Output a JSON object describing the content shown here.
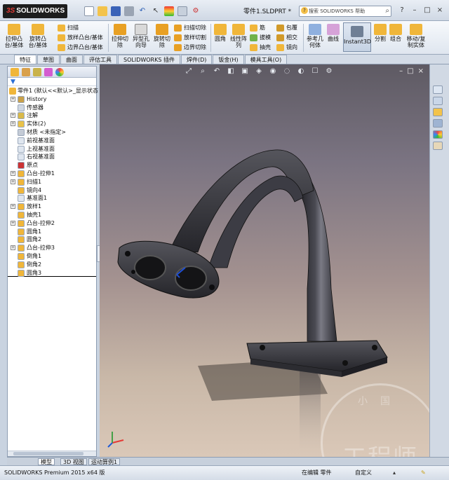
{
  "app": {
    "logo_text": "SOLIDWORKS",
    "doc_title": "零件1.SLDPRT *",
    "search_placeholder": "搜索 SOLIDWORKS 帮助"
  },
  "command_manager": {
    "boss_extrude": "拉伸凸台/基体",
    "revolve_boss": "旋转凸台/基体",
    "sweep": "扫描",
    "loft": "放样凸台/基体",
    "boundary_boss": "边界凸台/基体",
    "extruded_cut": "拉伸切除",
    "hole_wizard": "异型孔向导",
    "revolved_cut": "旋转切除",
    "swept_cut": "扫描切除",
    "lofted_cut": "放样切割",
    "boundary_cut": "边界切除",
    "fillet": "圆角",
    "linear_pattern": "线性阵列",
    "rib": "筋",
    "draft": "拔模",
    "shell": "抽壳",
    "wrap": "包覆",
    "intersect": "相交",
    "mirror": "镜向",
    "ref_geometry": "参考几何体",
    "curves": "曲线",
    "instant3d": "Instant3D",
    "split": "分割",
    "combine": "组合",
    "move_copy": "移动/复制实体"
  },
  "tabs": [
    "特征",
    "草图",
    "曲面",
    "评估工具",
    "SOLIDWORKS 插件",
    "焊件(D)",
    "钣金(H)",
    "模具工具(O)"
  ],
  "tree": [
    {
      "label": "零件1  (默认<<默认>_显示状态",
      "level": 0,
      "expand": false
    },
    {
      "label": "History",
      "level": 1,
      "expand": true
    },
    {
      "label": "传感器",
      "level": 1,
      "expand": false
    },
    {
      "label": "注解",
      "level": 1,
      "expand": true
    },
    {
      "label": "实体(2)",
      "level": 1,
      "expand": true
    },
    {
      "label": "材质 <未指定>",
      "level": 1,
      "expand": false
    },
    {
      "label": "前视基准面",
      "level": 1,
      "expand": false
    },
    {
      "label": "上视基准面",
      "level": 1,
      "expand": false
    },
    {
      "label": "右视基准面",
      "level": 1,
      "expand": false
    },
    {
      "label": "原点",
      "level": 1,
      "expand": false
    },
    {
      "label": "凸台-拉伸1",
      "level": 1,
      "expand": true
    },
    {
      "label": "扫描1",
      "level": 1,
      "expand": true
    },
    {
      "label": "镜向4",
      "level": 1,
      "expand": false
    },
    {
      "label": "基准面1",
      "level": 1,
      "expand": false
    },
    {
      "label": "放样1",
      "level": 1,
      "expand": true
    },
    {
      "label": "抽壳1",
      "level": 1,
      "expand": false
    },
    {
      "label": "凸台-拉伸2",
      "level": 1,
      "expand": true
    },
    {
      "label": "圆角1",
      "level": 1,
      "expand": false
    },
    {
      "label": "圆角2",
      "level": 1,
      "expand": false
    },
    {
      "label": "凸台-拉伸3",
      "level": 1,
      "expand": true
    },
    {
      "label": "倒角1",
      "level": 1,
      "expand": false
    },
    {
      "label": "倒角2",
      "level": 1,
      "expand": false
    },
    {
      "label": "圆角3",
      "level": 1,
      "expand": false
    }
  ],
  "bottom_tabs": [
    "模型",
    "3D 视图",
    "运动算例1"
  ],
  "watermark": {
    "text1": "工程师",
    "text2": "小国"
  },
  "status": {
    "product": "SOLIDWORKS Premium 2015 x64 版",
    "editing": "在编辑  零件",
    "units": "自定义"
  }
}
